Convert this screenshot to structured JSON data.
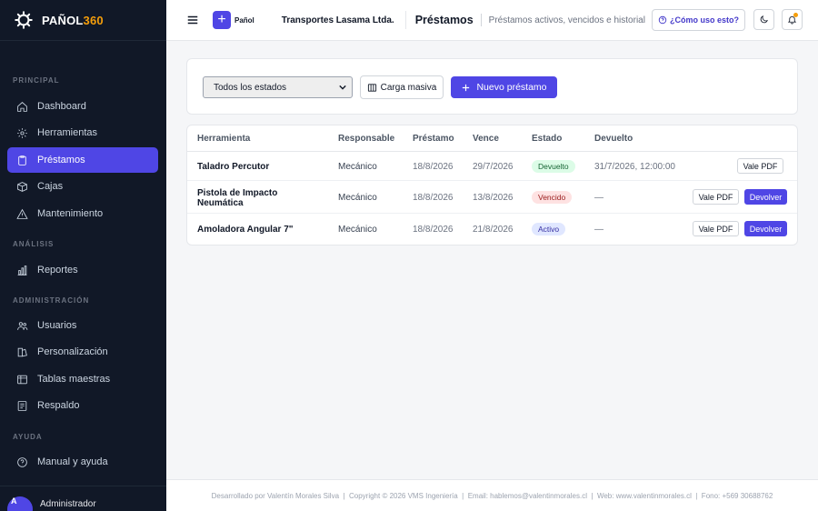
{
  "brand": {
    "name_main": "PAÑOL",
    "name_accent": "360"
  },
  "sidebar": {
    "sections": [
      {
        "title": "PRINCIPAL"
      },
      {
        "title": "ANÁLISIS"
      },
      {
        "title": "ADMINISTRACIÓN"
      },
      {
        "title": "AYUDA"
      }
    ],
    "items": [
      {
        "label": "Dashboard",
        "icon": "home-icon"
      },
      {
        "label": "Herramientas",
        "icon": "gear-icon"
      },
      {
        "label": "Préstamos",
        "icon": "clipboard-icon",
        "active": true
      },
      {
        "label": "Cajas",
        "icon": "box-icon"
      },
      {
        "label": "Mantenimiento",
        "icon": "warning-icon"
      },
      {
        "label": "Reportes",
        "icon": "bar-chart-icon"
      },
      {
        "label": "Usuarios",
        "icon": "users-icon"
      },
      {
        "label": "Personalización",
        "icon": "palette-icon"
      },
      {
        "label": "Tablas maestras",
        "icon": "table-icon"
      },
      {
        "label": "Respaldo",
        "icon": "backup-icon"
      },
      {
        "label": "Manual y ayuda",
        "icon": "help-icon"
      }
    ],
    "user": {
      "initial": "A",
      "name": "Administrador"
    }
  },
  "topbar": {
    "new_label": "Pañol",
    "company": "Transportes Lasama Ltda.",
    "title": "Préstamos",
    "subtitle": "Préstamos activos, vencidos e historial",
    "help_label": "¿Cómo uso esto?"
  },
  "filters": {
    "status_selected": "Todos los estados",
    "bulk_label": "Carga masiva",
    "new_loan_label": "Nuevo préstamo"
  },
  "table": {
    "headers": [
      "Herramienta",
      "Responsable",
      "Préstamo",
      "Vence",
      "Estado",
      "Devuelto"
    ],
    "rows": [
      {
        "tool": "Taladro Percutor",
        "owner": "Mecánico",
        "loan": "18/8/2026",
        "due": "29/7/2026",
        "status": "Devuelto",
        "returned": "31/7/2026, 12:00:00",
        "pdf": "Vale PDF"
      },
      {
        "tool": "Pistola de Impacto Neumática",
        "owner": "Mecánico",
        "loan": "18/8/2026",
        "due": "13/8/2026",
        "status": "Vencido",
        "returned": "—",
        "pdf": "Vale PDF",
        "return_btn": "Devolver"
      },
      {
        "tool": "Amoladora Angular 7\"",
        "owner": "Mecánico",
        "loan": "18/8/2026",
        "due": "21/8/2026",
        "status": "Activo",
        "returned": "—",
        "pdf": "Vale PDF",
        "return_btn": "Devolver"
      }
    ]
  },
  "colors": {
    "accent": "#4f46e5",
    "sidebar_bg": "#111827",
    "brand_accent": "#f59e0b"
  },
  "footer": "Desarrollado por Valentín Morales Silva  |  Copyright © 2026 VMS Ingeniería  |  Email: hablemos@valentinmorales.cl  |  Web: www.valentinmorales.cl  |  Fono: +569 30688762"
}
